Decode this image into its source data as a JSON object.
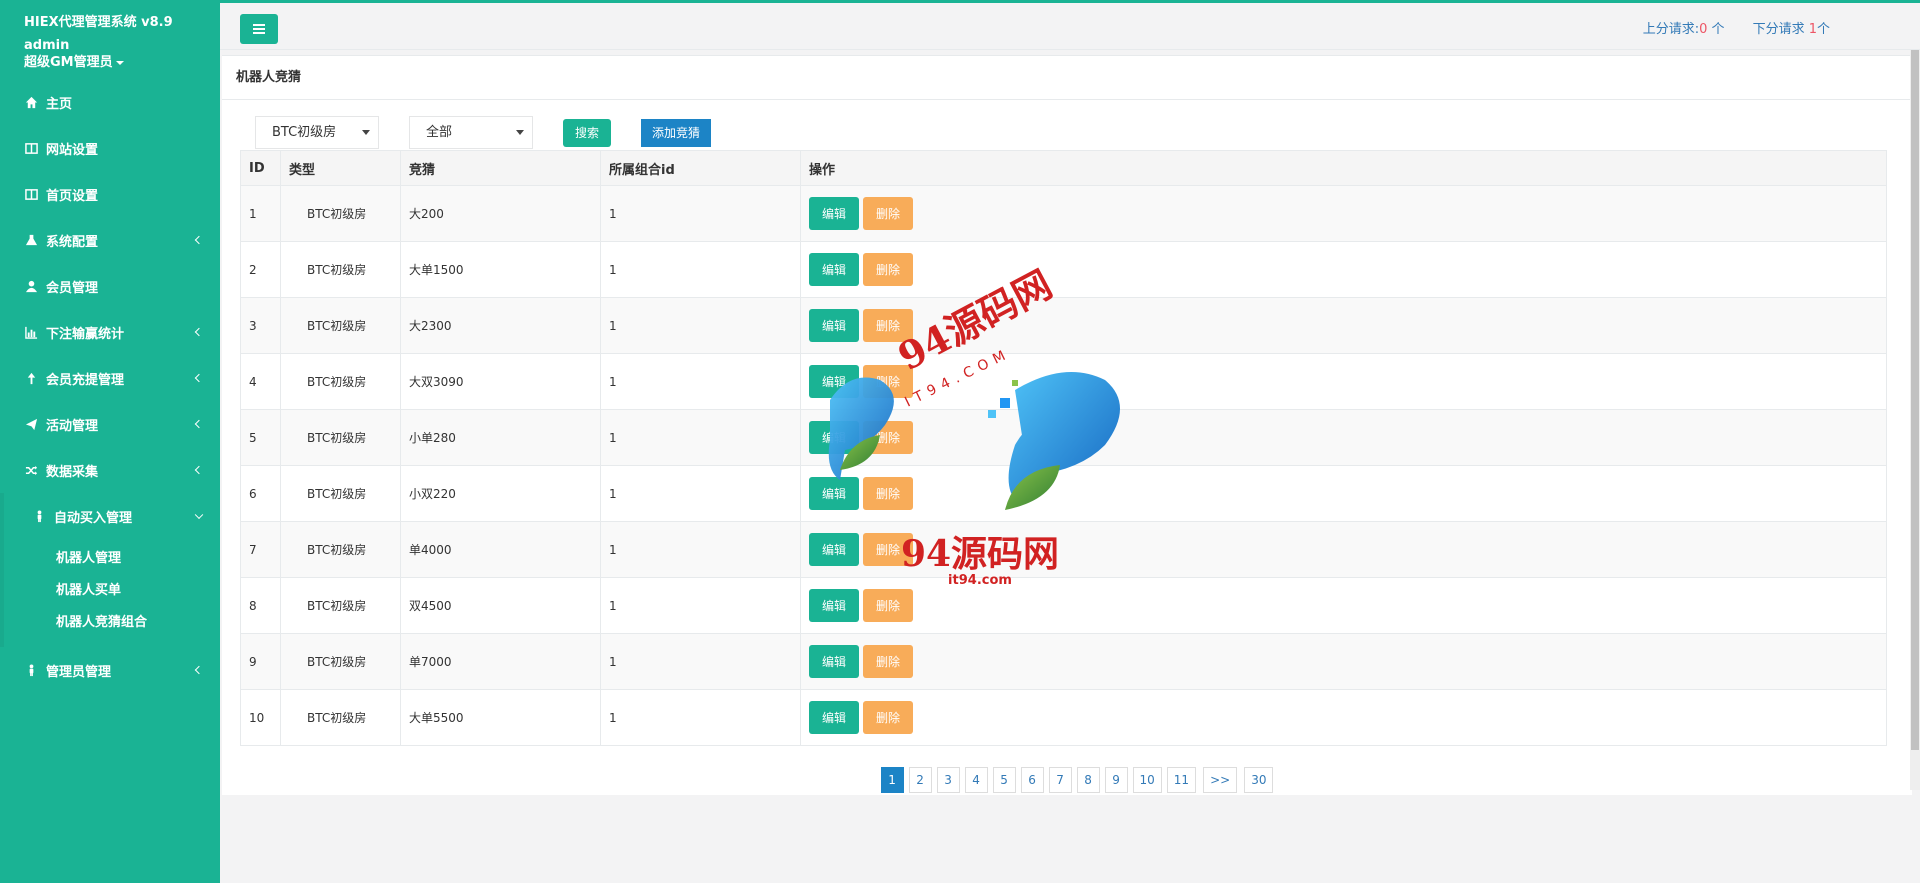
{
  "sidebar": {
    "title": "HIEX代理管理系统 v8.9",
    "user": "admin",
    "role": "超级GM管理员",
    "items": [
      {
        "label": "主页",
        "icon": "home-icon",
        "arrow": false
      },
      {
        "label": "网站设置",
        "icon": "columns-icon",
        "arrow": false
      },
      {
        "label": "首页设置",
        "icon": "columns-icon",
        "arrow": false
      },
      {
        "label": "系统配置",
        "icon": "flask-icon",
        "arrow": true
      },
      {
        "label": "会员管理",
        "icon": "user-icon",
        "arrow": false
      },
      {
        "label": "下注输赢统计",
        "icon": "bar-chart-icon",
        "arrow": true
      },
      {
        "label": "会员充提管理",
        "icon": "arrow-up-icon",
        "arrow": true
      },
      {
        "label": "活动管理",
        "icon": "paper-plane-icon",
        "arrow": true
      },
      {
        "label": "数据采集",
        "icon": "random-icon",
        "arrow": true
      },
      {
        "label": "自动买入管理",
        "icon": "male-icon",
        "arrow": true
      },
      {
        "label": "管理员管理",
        "icon": "male-icon",
        "arrow": true
      }
    ],
    "submenu": [
      "机器人管理",
      "机器人买单",
      "机器人竞猜组合"
    ]
  },
  "topbar": {
    "up_label": "上分请求:",
    "up_count": "0",
    "up_unit": " 个",
    "down_label": "下分请求 ",
    "down_count": "1",
    "down_unit": "个"
  },
  "panel": {
    "title": "机器人竞猜",
    "filter_room": "BTC初级房",
    "filter_bet": "全部",
    "search_label": "搜索",
    "add_label": "添加竞猜"
  },
  "table": {
    "headers": {
      "id": "ID",
      "type": "类型",
      "bet": "竞猜",
      "group": "所属组合id",
      "op": "操作"
    },
    "edit_label": "编辑",
    "delete_label": "删除",
    "rows": [
      {
        "id": "1",
        "type": "BTC初级房",
        "bet": "大200",
        "group": "1"
      },
      {
        "id": "2",
        "type": "BTC初级房",
        "bet": "大单1500",
        "group": "1"
      },
      {
        "id": "3",
        "type": "BTC初级房",
        "bet": "大2300",
        "group": "1"
      },
      {
        "id": "4",
        "type": "BTC初级房",
        "bet": "大双3090",
        "group": "1"
      },
      {
        "id": "5",
        "type": "BTC初级房",
        "bet": "小单280",
        "group": "1"
      },
      {
        "id": "6",
        "type": "BTC初级房",
        "bet": "小双220",
        "group": "1"
      },
      {
        "id": "7",
        "type": "BTC初级房",
        "bet": "单4000",
        "group": "1"
      },
      {
        "id": "8",
        "type": "BTC初级房",
        "bet": "双4500",
        "group": "1"
      },
      {
        "id": "9",
        "type": "BTC初级房",
        "bet": "单7000",
        "group": "1"
      },
      {
        "id": "10",
        "type": "BTC初级房",
        "bet": "大单5500",
        "group": "1"
      }
    ]
  },
  "pagination": {
    "pages": [
      "1",
      "2",
      "3",
      "4",
      "5",
      "6",
      "7",
      "8",
      "9",
      "10",
      "11"
    ],
    "active": "1",
    "next": ">>",
    "last": "30"
  },
  "watermark": {
    "brand": "94源码网",
    "domain": "it94.com",
    "arc_domain": "IT94.COM"
  },
  "colors": {
    "accent": "#1ab394",
    "primary": "#1c84c6",
    "warning": "#f8ac59",
    "danger": "#ed5565",
    "link": "#337ab7"
  }
}
